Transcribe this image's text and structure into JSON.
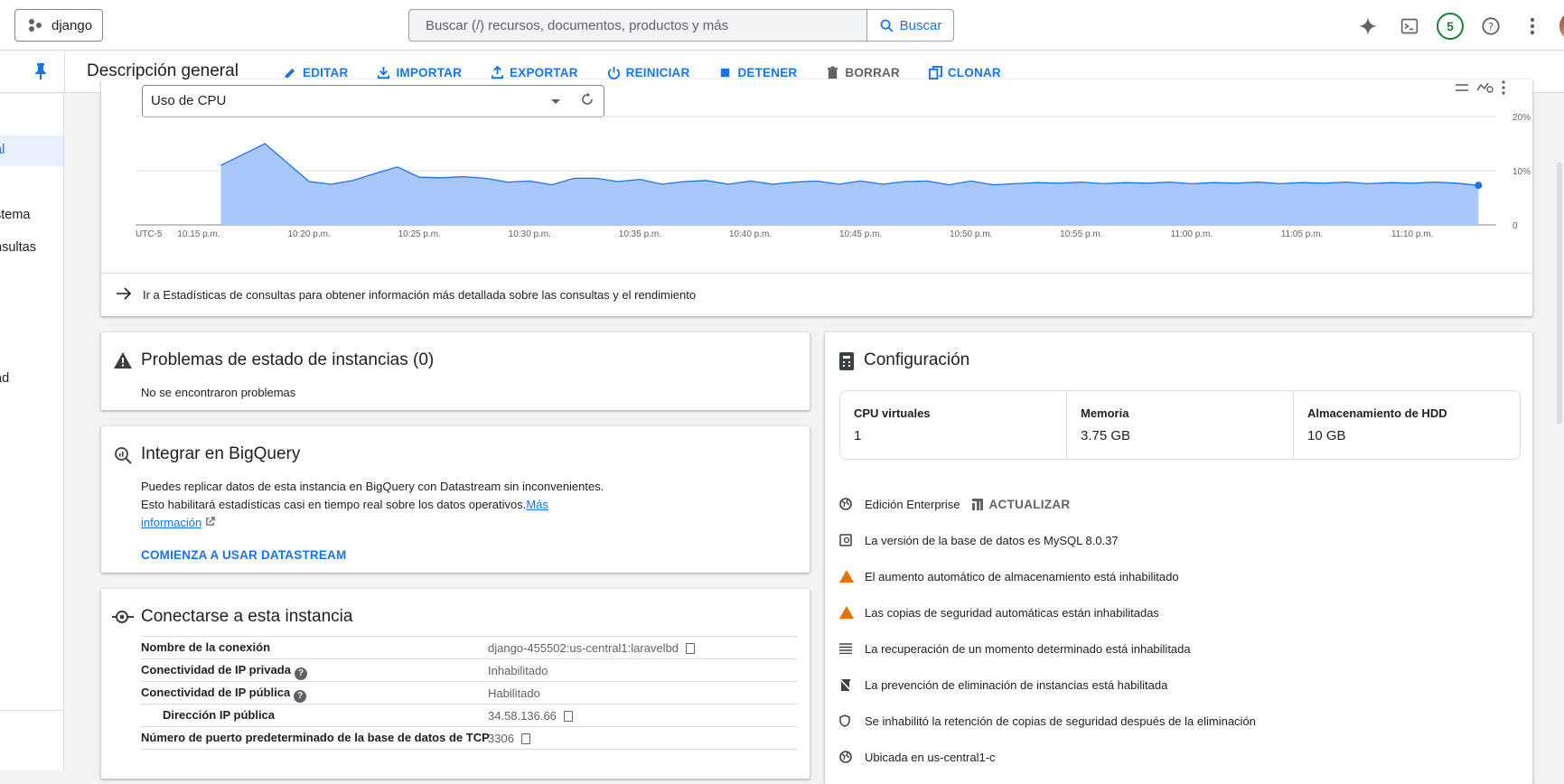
{
  "topbar": {
    "project": "django",
    "search_placeholder": "Buscar (/) recursos, documentos, productos y más",
    "search_button": "Buscar",
    "notifications_count": "5"
  },
  "subbar": {
    "title": "Descripción general",
    "actions": [
      "EDITAR",
      "IMPORTAR",
      "EXPORTAR",
      "REINICIAR",
      "DETENER",
      "BORRAR",
      "CLONAR"
    ]
  },
  "leftnav": {
    "items": [
      "al",
      "stema",
      "nsultas",
      "ad"
    ]
  },
  "chart": {
    "metric": "Uso de CPU",
    "link_text": "Ir a Estadísticas de consultas para obtener información más detallada sobre las consultas y el rendimiento"
  },
  "chart_data": {
    "type": "area",
    "timezone_label": "UTC-5",
    "x_ticks": [
      "10:15 p.m.",
      "10:20 p.m.",
      "10:25 p.m.",
      "10:30 p.m.",
      "10:35 p.m.",
      "10:40 p.m.",
      "10:45 p.m.",
      "10:50 p.m.",
      "10:55 p.m.",
      "11:00 p.m.",
      "11:05 p.m.",
      "11:10 p.m."
    ],
    "y_ticks": [
      "20%",
      "10%",
      "0"
    ],
    "ylim": [
      0,
      20
    ],
    "x_minutes_from_1015": [
      1,
      3,
      5,
      6,
      7,
      8,
      9,
      10,
      11,
      12,
      13,
      14,
      15,
      16,
      17,
      18,
      19,
      20,
      21,
      22,
      23,
      24,
      25,
      26,
      27,
      28,
      29,
      30,
      31,
      32,
      33,
      34,
      35,
      36,
      37,
      38,
      39,
      40,
      41,
      42,
      43,
      44,
      45,
      46,
      47,
      48,
      49,
      50,
      51,
      52,
      53,
      54,
      55,
      56,
      57,
      58
    ],
    "values": [
      11,
      15,
      8,
      7.5,
      8.2,
      9.5,
      10.7,
      8.8,
      8.7,
      8.9,
      8.6,
      7.9,
      8.1,
      7.4,
      8.6,
      8.6,
      8.0,
      8.4,
      7.5,
      8.0,
      8.2,
      7.5,
      8.1,
      7.5,
      7.9,
      8.1,
      7.5,
      8.1,
      7.5,
      8.0,
      8.1,
      7.4,
      8.1,
      7.4,
      7.6,
      7.8,
      7.7,
      7.9,
      7.6,
      7.8,
      7.7,
      7.9,
      7.6,
      7.8,
      7.7,
      7.9,
      7.6,
      7.8,
      7.7,
      7.9,
      7.6,
      7.8,
      7.7,
      7.9,
      7.7,
      7.3
    ],
    "color": "#a8c7fa",
    "line_color": "#1a73e8"
  },
  "problems": {
    "title": "Problemas de estado de instancias (0)",
    "text": "No se encontraron problemas"
  },
  "bigquery": {
    "title": "Integrar en BigQuery",
    "line1": "Puedes replicar datos de esta instancia en BigQuery con Datastream sin inconvenientes.",
    "line2": "Esto habilitará estadísticas casi en tiempo real sobre los datos operativos.",
    "link1": "Más",
    "link2": "información",
    "cta": "COMIENZA A USAR DATASTREAM"
  },
  "connect": {
    "title": "Conectarse a esta instancia",
    "rows": [
      {
        "key": "Nombre de la conexión",
        "value": "django-455502:us-central1:laravelbd"
      },
      {
        "key": "Conectividad de IP privada",
        "value": "Inhabilitado"
      },
      {
        "key": "Conectividad de IP pública",
        "value": "Habilitado"
      },
      {
        "key": "Dirección IP pública",
        "value": "34.58.136.66"
      },
      {
        "key": "Número de puerto predeterminado de la base de datos de TCP",
        "value": "3306"
      }
    ]
  },
  "config": {
    "title": "Configuración",
    "cpu_label": "CPU virtuales",
    "cpu_value": "1",
    "mem_label": "Memoria",
    "mem_value": "3.75 GB",
    "hdd_label": "Almacenamiento de HDD",
    "hdd_value": "10 GB",
    "edition": "Edición Enterprise",
    "upgrade": "ACTUALIZAR",
    "items": [
      "La versión de la base de datos es MySQL 8.0.37",
      "El aumento automático de almacenamiento está inhabilitado",
      "Las copias de seguridad automáticas están inhabilitadas",
      "La recuperación de un momento determinado está inhabilitada",
      "La prevención de eliminación de instancias está habilitada",
      "Se inhabilitó la retención de copias de seguridad después de la eliminación",
      "Ubicada en us-central1-c"
    ]
  }
}
